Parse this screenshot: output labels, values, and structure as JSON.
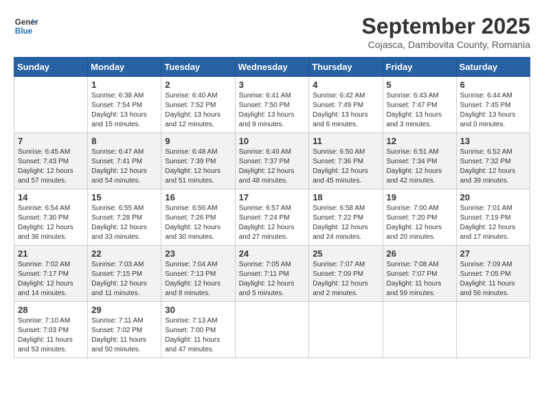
{
  "header": {
    "logo_line1": "General",
    "logo_line2": "Blue",
    "month_year": "September 2025",
    "location": "Cojasca, Dambovita County, Romania"
  },
  "weekdays": [
    "Sunday",
    "Monday",
    "Tuesday",
    "Wednesday",
    "Thursday",
    "Friday",
    "Saturday"
  ],
  "weeks": [
    [
      {
        "day": "",
        "sunrise": "",
        "sunset": "",
        "daylight": ""
      },
      {
        "day": "1",
        "sunrise": "Sunrise: 6:38 AM",
        "sunset": "Sunset: 7:54 PM",
        "daylight": "Daylight: 13 hours and 15 minutes."
      },
      {
        "day": "2",
        "sunrise": "Sunrise: 6:40 AM",
        "sunset": "Sunset: 7:52 PM",
        "daylight": "Daylight: 13 hours and 12 minutes."
      },
      {
        "day": "3",
        "sunrise": "Sunrise: 6:41 AM",
        "sunset": "Sunset: 7:50 PM",
        "daylight": "Daylight: 13 hours and 9 minutes."
      },
      {
        "day": "4",
        "sunrise": "Sunrise: 6:42 AM",
        "sunset": "Sunset: 7:49 PM",
        "daylight": "Daylight: 13 hours and 6 minutes."
      },
      {
        "day": "5",
        "sunrise": "Sunrise: 6:43 AM",
        "sunset": "Sunset: 7:47 PM",
        "daylight": "Daylight: 13 hours and 3 minutes."
      },
      {
        "day": "6",
        "sunrise": "Sunrise: 6:44 AM",
        "sunset": "Sunset: 7:45 PM",
        "daylight": "Daylight: 13 hours and 0 minutes."
      }
    ],
    [
      {
        "day": "7",
        "sunrise": "Sunrise: 6:45 AM",
        "sunset": "Sunset: 7:43 PM",
        "daylight": "Daylight: 12 hours and 57 minutes."
      },
      {
        "day": "8",
        "sunrise": "Sunrise: 6:47 AM",
        "sunset": "Sunset: 7:41 PM",
        "daylight": "Daylight: 12 hours and 54 minutes."
      },
      {
        "day": "9",
        "sunrise": "Sunrise: 6:48 AM",
        "sunset": "Sunset: 7:39 PM",
        "daylight": "Daylight: 12 hours and 51 minutes."
      },
      {
        "day": "10",
        "sunrise": "Sunrise: 6:49 AM",
        "sunset": "Sunset: 7:37 PM",
        "daylight": "Daylight: 12 hours and 48 minutes."
      },
      {
        "day": "11",
        "sunrise": "Sunrise: 6:50 AM",
        "sunset": "Sunset: 7:36 PM",
        "daylight": "Daylight: 12 hours and 45 minutes."
      },
      {
        "day": "12",
        "sunrise": "Sunrise: 6:51 AM",
        "sunset": "Sunset: 7:34 PM",
        "daylight": "Daylight: 12 hours and 42 minutes."
      },
      {
        "day": "13",
        "sunrise": "Sunrise: 6:52 AM",
        "sunset": "Sunset: 7:32 PM",
        "daylight": "Daylight: 12 hours and 39 minutes."
      }
    ],
    [
      {
        "day": "14",
        "sunrise": "Sunrise: 6:54 AM",
        "sunset": "Sunset: 7:30 PM",
        "daylight": "Daylight: 12 hours and 36 minutes."
      },
      {
        "day": "15",
        "sunrise": "Sunrise: 6:55 AM",
        "sunset": "Sunset: 7:28 PM",
        "daylight": "Daylight: 12 hours and 33 minutes."
      },
      {
        "day": "16",
        "sunrise": "Sunrise: 6:56 AM",
        "sunset": "Sunset: 7:26 PM",
        "daylight": "Daylight: 12 hours and 30 minutes."
      },
      {
        "day": "17",
        "sunrise": "Sunrise: 6:57 AM",
        "sunset": "Sunset: 7:24 PM",
        "daylight": "Daylight: 12 hours and 27 minutes."
      },
      {
        "day": "18",
        "sunrise": "Sunrise: 6:58 AM",
        "sunset": "Sunset: 7:22 PM",
        "daylight": "Daylight: 12 hours and 24 minutes."
      },
      {
        "day": "19",
        "sunrise": "Sunrise: 7:00 AM",
        "sunset": "Sunset: 7:20 PM",
        "daylight": "Daylight: 12 hours and 20 minutes."
      },
      {
        "day": "20",
        "sunrise": "Sunrise: 7:01 AM",
        "sunset": "Sunset: 7:19 PM",
        "daylight": "Daylight: 12 hours and 17 minutes."
      }
    ],
    [
      {
        "day": "21",
        "sunrise": "Sunrise: 7:02 AM",
        "sunset": "Sunset: 7:17 PM",
        "daylight": "Daylight: 12 hours and 14 minutes."
      },
      {
        "day": "22",
        "sunrise": "Sunrise: 7:03 AM",
        "sunset": "Sunset: 7:15 PM",
        "daylight": "Daylight: 12 hours and 11 minutes."
      },
      {
        "day": "23",
        "sunrise": "Sunrise: 7:04 AM",
        "sunset": "Sunset: 7:13 PM",
        "daylight": "Daylight: 12 hours and 8 minutes."
      },
      {
        "day": "24",
        "sunrise": "Sunrise: 7:05 AM",
        "sunset": "Sunset: 7:11 PM",
        "daylight": "Daylight: 12 hours and 5 minutes."
      },
      {
        "day": "25",
        "sunrise": "Sunrise: 7:07 AM",
        "sunset": "Sunset: 7:09 PM",
        "daylight": "Daylight: 12 hours and 2 minutes."
      },
      {
        "day": "26",
        "sunrise": "Sunrise: 7:08 AM",
        "sunset": "Sunset: 7:07 PM",
        "daylight": "Daylight: 11 hours and 59 minutes."
      },
      {
        "day": "27",
        "sunrise": "Sunrise: 7:09 AM",
        "sunset": "Sunset: 7:05 PM",
        "daylight": "Daylight: 11 hours and 56 minutes."
      }
    ],
    [
      {
        "day": "28",
        "sunrise": "Sunrise: 7:10 AM",
        "sunset": "Sunset: 7:03 PM",
        "daylight": "Daylight: 11 hours and 53 minutes."
      },
      {
        "day": "29",
        "sunrise": "Sunrise: 7:11 AM",
        "sunset": "Sunset: 7:02 PM",
        "daylight": "Daylight: 11 hours and 50 minutes."
      },
      {
        "day": "30",
        "sunrise": "Sunrise: 7:13 AM",
        "sunset": "Sunset: 7:00 PM",
        "daylight": "Daylight: 11 hours and 47 minutes."
      },
      {
        "day": "",
        "sunrise": "",
        "sunset": "",
        "daylight": ""
      },
      {
        "day": "",
        "sunrise": "",
        "sunset": "",
        "daylight": ""
      },
      {
        "day": "",
        "sunrise": "",
        "sunset": "",
        "daylight": ""
      },
      {
        "day": "",
        "sunrise": "",
        "sunset": "",
        "daylight": ""
      }
    ]
  ]
}
